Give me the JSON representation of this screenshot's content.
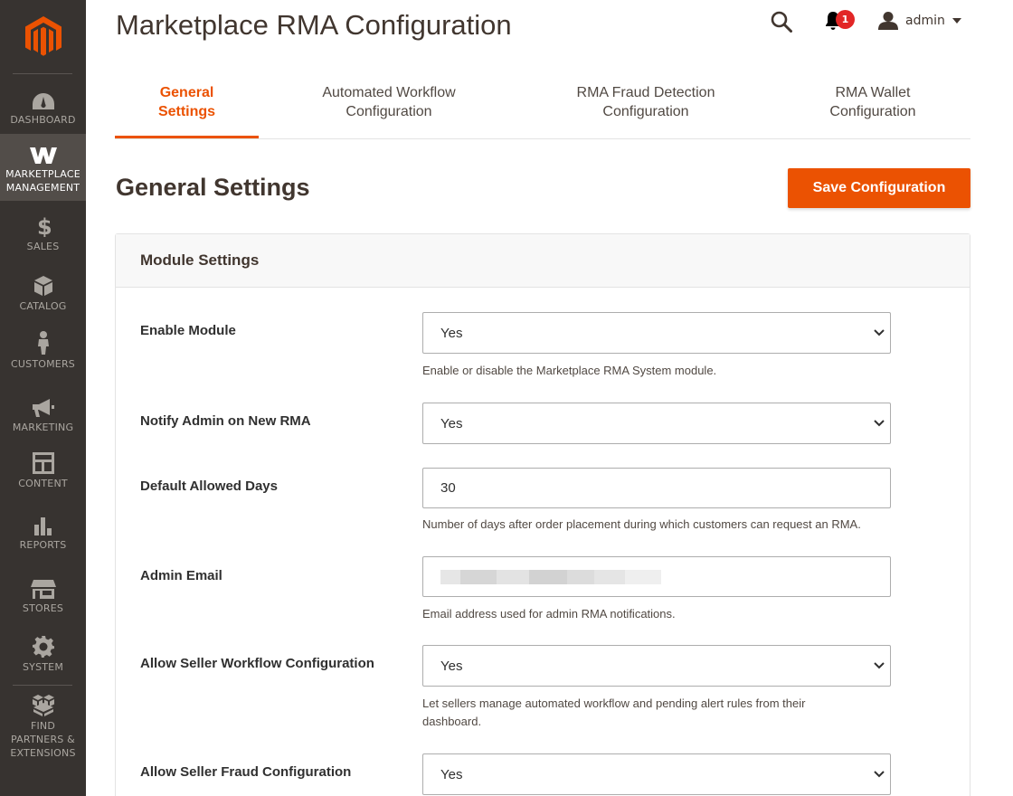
{
  "colors": {
    "accent": "#eb5202",
    "sidebar_bg": "#373330",
    "sidebar_active": "#524d49",
    "badge": "#e22626"
  },
  "sidebar": {
    "items": [
      {
        "label": "DASHBOARD",
        "icon": "dashboard-icon"
      },
      {
        "label": "MARKETPLACE MANAGEMENT",
        "icon": "marketplace-icon",
        "active": true
      },
      {
        "label": "SALES",
        "icon": "dollar-icon"
      },
      {
        "label": "CATALOG",
        "icon": "box-icon"
      },
      {
        "label": "CUSTOMERS",
        "icon": "person-icon"
      },
      {
        "label": "MARKETING",
        "icon": "megaphone-icon"
      },
      {
        "label": "CONTENT",
        "icon": "content-icon"
      },
      {
        "label": "REPORTS",
        "icon": "bar-chart-icon"
      },
      {
        "label": "STORES",
        "icon": "store-icon"
      },
      {
        "label": "SYSTEM",
        "icon": "gear-icon"
      },
      {
        "label": "FIND PARTNERS & EXTENSIONS",
        "icon": "extensions-icon"
      }
    ]
  },
  "header": {
    "title": "Marketplace RMA Configuration",
    "notifications_count": "1",
    "user": "admin"
  },
  "tabs": [
    {
      "label": "General Settings",
      "active": true
    },
    {
      "label": "Automated Workflow Configuration"
    },
    {
      "label": "RMA Fraud Detection Configuration"
    },
    {
      "label": "RMA Wallet Configuration"
    }
  ],
  "section_title": "General Settings",
  "save_label": "Save Configuration",
  "card": {
    "title": "Module Settings",
    "fields": [
      {
        "label": "Enable Module",
        "type": "select",
        "value": "Yes",
        "help": "Enable or disable the Marketplace RMA System module."
      },
      {
        "label": "Notify Admin on New RMA",
        "type": "select",
        "value": "Yes",
        "help": ""
      },
      {
        "label": "Default Allowed Days",
        "type": "text",
        "value": "30",
        "help": "Number of days after order placement during which customers can request an RMA."
      },
      {
        "label": "Admin Email",
        "type": "text",
        "value": "",
        "help": "Email address used for admin RMA notifications."
      },
      {
        "label": "Allow Seller Workflow Configuration",
        "type": "select",
        "value": "Yes",
        "help": "Let sellers manage automated workflow and pending alert rules from their dashboard."
      },
      {
        "label": "Allow Seller Fraud Configuration",
        "type": "select",
        "value": "Yes",
        "help": ""
      }
    ]
  }
}
